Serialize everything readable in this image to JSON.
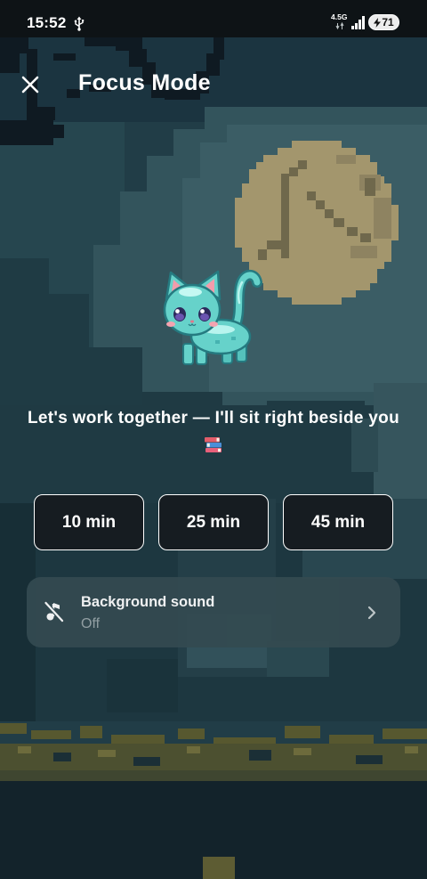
{
  "status_bar": {
    "time": "15:52",
    "usb_icon": "usb-icon",
    "network_type": "4.5G",
    "network_activity_icon": "data-activity-icon",
    "signal_icon": "signal-bars-icon",
    "battery_charging_icon": "lightning-bolt-icon",
    "battery_level": "71"
  },
  "header": {
    "close_icon": "close-icon",
    "title": "Focus Mode"
  },
  "companion": {
    "image": "pixel-cat-image",
    "message": "Let's work together — I'll sit right beside you",
    "emoji_icon": "books-emoji-icon"
  },
  "durations": [
    {
      "label": "10 min"
    },
    {
      "label": "25 min"
    },
    {
      "label": "45 min"
    }
  ],
  "background_sound": {
    "icon": "music-off-icon",
    "title": "Background sound",
    "value": "Off",
    "chevron_icon": "chevron-right-icon"
  },
  "colors": {
    "text_primary": "#ffffff",
    "text_secondary": "#9ba7ab",
    "button_bg": "#161c21",
    "button_border": "#ffffff",
    "card_bg": "#344a51",
    "status_bar_bg": "#0e1316",
    "moon": "#a3966d",
    "cat_body": "#66d2ca"
  }
}
